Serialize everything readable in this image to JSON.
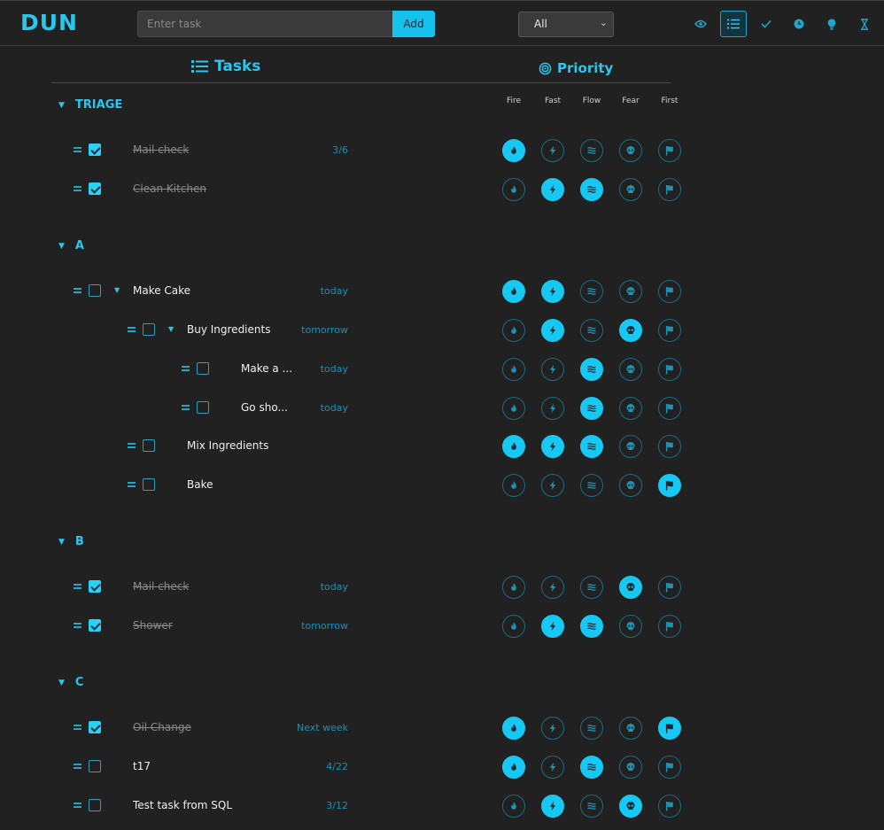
{
  "app": {
    "logo": "DUN"
  },
  "toolbar": {
    "input_placeholder": "Enter task",
    "add_label": "Add",
    "filter_value": "All",
    "icons": [
      "eye-icon",
      "list-icon",
      "check-icon",
      "clock-icon",
      "lightbulb-icon",
      "hourglass-icon"
    ],
    "active_icon": "list-icon"
  },
  "headers": {
    "tasks": "Tasks",
    "priority": "Priority"
  },
  "priority_columns": [
    "Fire",
    "Fast",
    "Flow",
    "Fear",
    "First"
  ],
  "colors": {
    "accent": "#17c8f2",
    "background": "#212121",
    "due": "#1e8fb3"
  },
  "groups": [
    {
      "name": "TRIAGE",
      "tasks": [
        {
          "name": "Mail check",
          "due": "3/6",
          "done": true,
          "depth": 0,
          "expandable": false,
          "priority": [
            1,
            0,
            0,
            0,
            0
          ]
        },
        {
          "name": "Clean Kitchen",
          "due": "",
          "done": true,
          "depth": 0,
          "expandable": false,
          "priority": [
            0,
            1,
            1,
            0,
            0
          ]
        }
      ]
    },
    {
      "name": "A",
      "tasks": [
        {
          "name": "Make Cake",
          "due": "today",
          "done": false,
          "depth": 0,
          "expandable": true,
          "priority": [
            1,
            1,
            0,
            0,
            0
          ]
        },
        {
          "name": "Buy Ingredients",
          "due": "tomorrow",
          "done": false,
          "depth": 1,
          "expandable": true,
          "priority": [
            0,
            1,
            0,
            1,
            0
          ]
        },
        {
          "name": "Make a ...",
          "due": "today",
          "done": false,
          "depth": 2,
          "expandable": false,
          "priority": [
            0,
            0,
            1,
            0,
            0
          ]
        },
        {
          "name": "Go sho...",
          "due": "today",
          "done": false,
          "depth": 2,
          "expandable": false,
          "priority": [
            0,
            0,
            1,
            0,
            0
          ]
        },
        {
          "name": "Mix Ingredients",
          "due": "",
          "done": false,
          "depth": 1,
          "expandable": false,
          "priority": [
            1,
            1,
            1,
            0,
            0
          ]
        },
        {
          "name": "Bake",
          "due": "",
          "done": false,
          "depth": 1,
          "expandable": false,
          "priority": [
            0,
            0,
            0,
            0,
            1
          ]
        }
      ]
    },
    {
      "name": "B",
      "tasks": [
        {
          "name": "Mail check",
          "due": "today",
          "done": true,
          "depth": 0,
          "expandable": false,
          "priority": [
            0,
            0,
            0,
            1,
            0
          ]
        },
        {
          "name": "Shower",
          "due": "tomorrow",
          "done": true,
          "depth": 0,
          "expandable": false,
          "priority": [
            0,
            1,
            1,
            0,
            0
          ]
        }
      ]
    },
    {
      "name": "C",
      "tasks": [
        {
          "name": "Oil Change",
          "due": "Next week",
          "done": true,
          "depth": 0,
          "expandable": false,
          "priority": [
            1,
            0,
            0,
            0,
            1
          ]
        },
        {
          "name": "t17",
          "due": "4/22",
          "done": false,
          "depth": 0,
          "expandable": false,
          "priority": [
            1,
            0,
            1,
            0,
            0
          ]
        },
        {
          "name": "Test task from SQL",
          "due": "3/12",
          "done": false,
          "depth": 0,
          "expandable": false,
          "priority": [
            0,
            1,
            0,
            1,
            0
          ]
        }
      ]
    }
  ]
}
